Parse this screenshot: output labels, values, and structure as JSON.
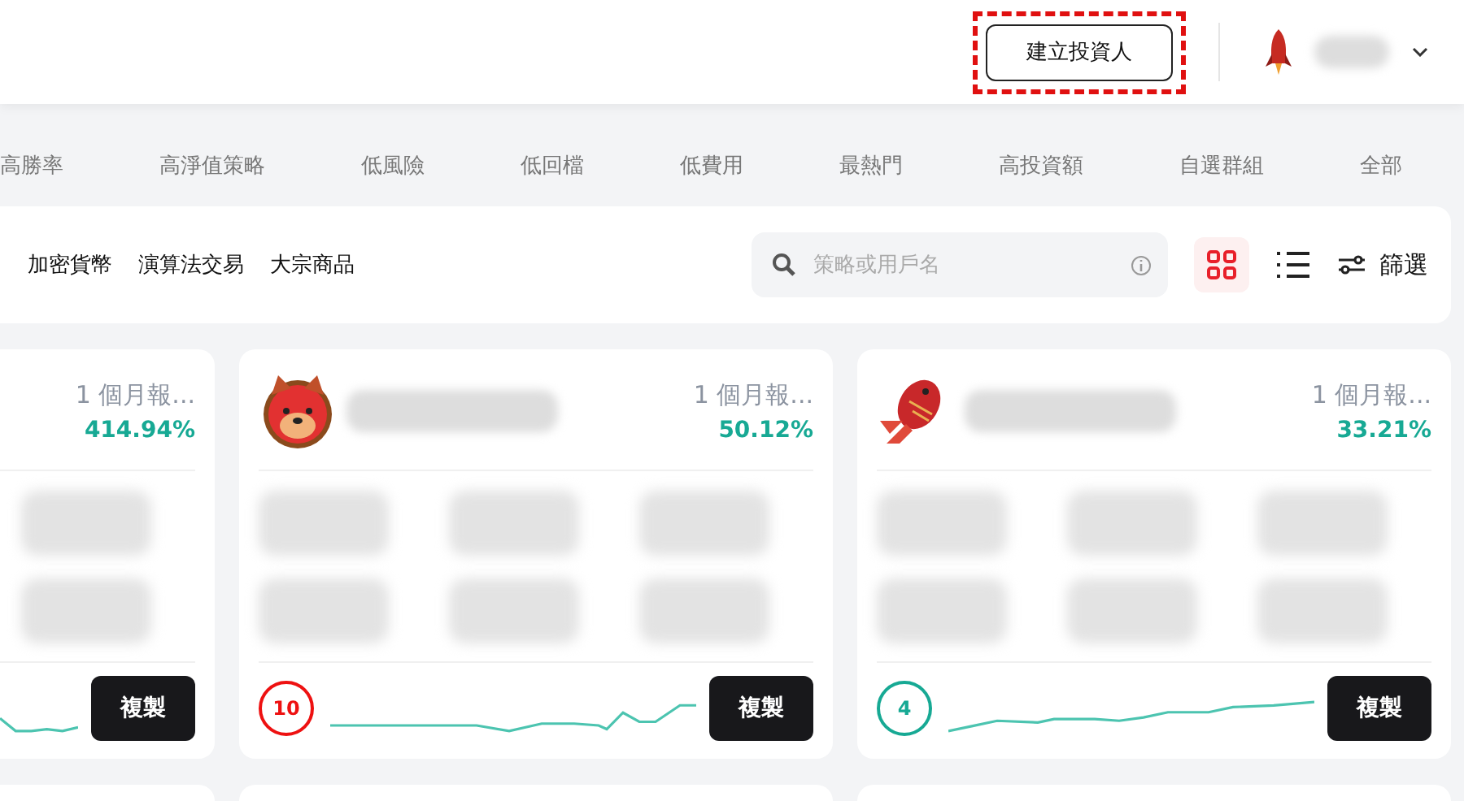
{
  "header": {
    "create_button": {
      "label": "建立投資人",
      "highlighted": true
    }
  },
  "categories": [
    "高勝率",
    "高淨值策略",
    "低風險",
    "低回檔",
    "低費用",
    "最熱門",
    "高投資額",
    "自選群組",
    "全部"
  ],
  "filters": {
    "tags": [
      "加密貨幣",
      "演算法交易",
      "大宗商品"
    ],
    "search": {
      "placeholder": "策略或用戶名"
    },
    "views": [
      {
        "kind": "grid",
        "selected": true
      },
      {
        "kind": "list",
        "selected": false
      }
    ],
    "filter_button": {
      "label": "篩選"
    }
  },
  "cards": [
    {
      "return_label": "1 個月報...",
      "return_value": "414.94%",
      "copy_label": "複製"
    },
    {
      "kind": "dog",
      "return_label": "1 個月報...",
      "return_value": "50.12%",
      "risk": "10",
      "color": "#ee1111",
      "copy_label": "複製"
    },
    {
      "kind": "koi",
      "return_label": "1 個月報...",
      "return_value": "33.21%",
      "risk": "4",
      "color": "#17a994",
      "copy_label": "複製"
    }
  ]
}
